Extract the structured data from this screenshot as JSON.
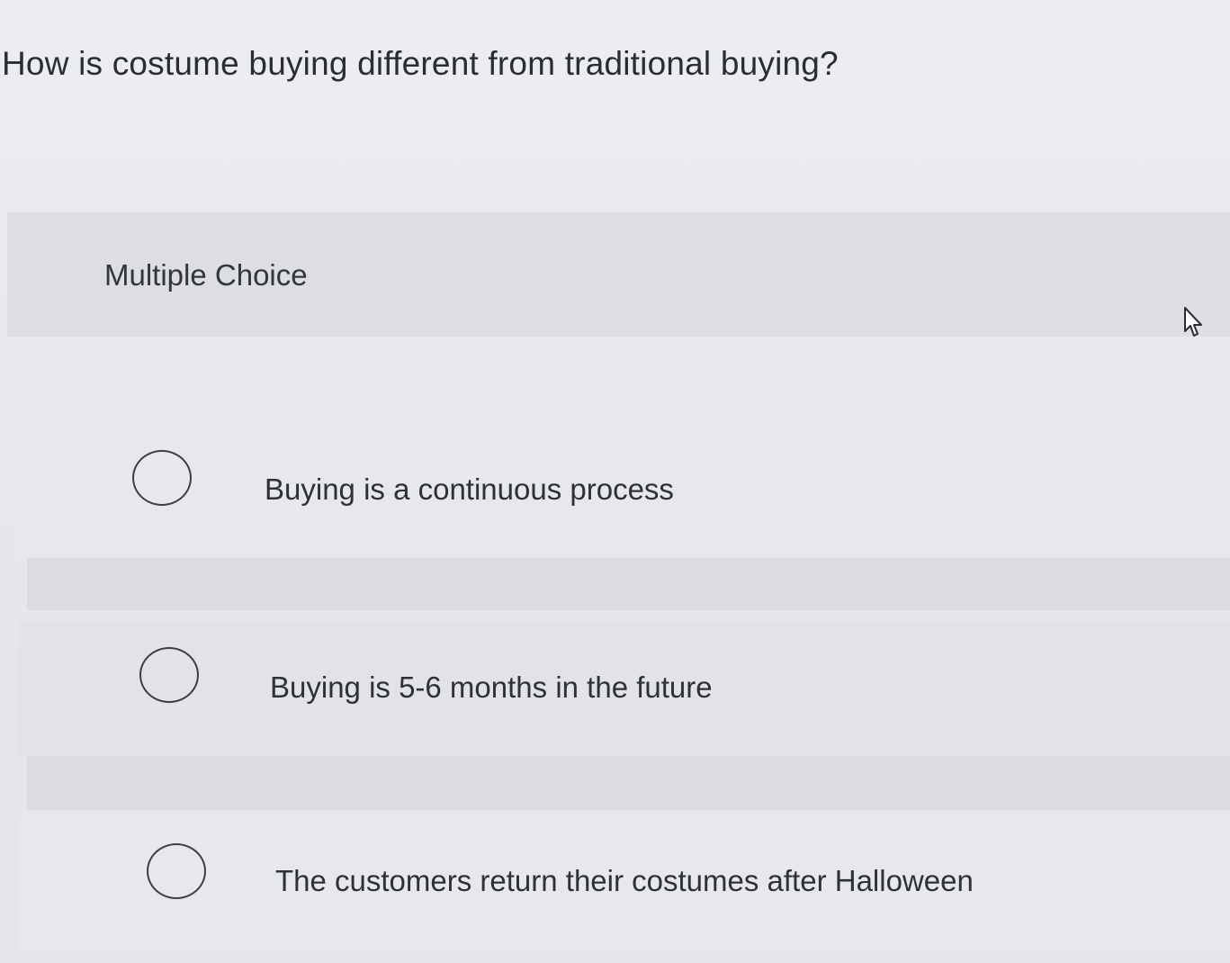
{
  "question": {
    "text": "How is costume buying different from traditional buying?"
  },
  "quiz": {
    "type_label": "Multiple Choice",
    "options": [
      {
        "label": "Buying is a continuous process",
        "selected": false
      },
      {
        "label": "Buying is 5-6 months in the future",
        "selected": false
      },
      {
        "label": "The customers return their costumes after Halloween",
        "selected": false
      }
    ]
  },
  "icons": {
    "pointer": "mouse-pointer-icon",
    "radio": "radio-button-icon"
  }
}
